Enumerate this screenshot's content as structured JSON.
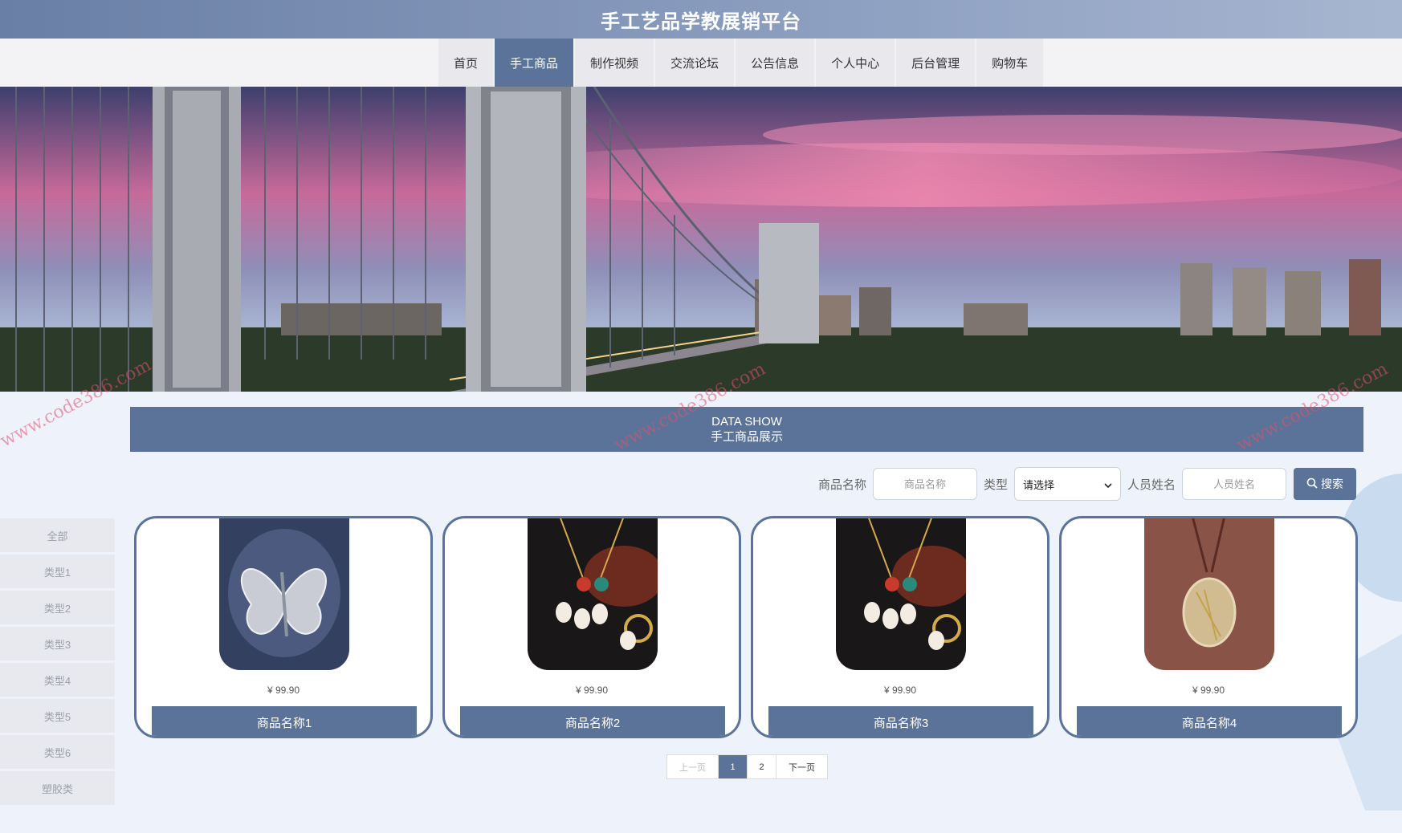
{
  "header": {
    "title": "手工艺品学教展销平台"
  },
  "nav": {
    "items": [
      {
        "label": "首页"
      },
      {
        "label": "手工商品"
      },
      {
        "label": "制作视频"
      },
      {
        "label": "交流论坛"
      },
      {
        "label": "公告信息"
      },
      {
        "label": "个人中心"
      },
      {
        "label": "后台管理"
      },
      {
        "label": "购物车"
      }
    ],
    "active_index": 1
  },
  "section": {
    "title_en": "DATA SHOW",
    "title_cn": "手工商品展示"
  },
  "search": {
    "name_label": "商品名称",
    "name_placeholder": "商品名称",
    "type_label": "类型",
    "type_selected": "请选择",
    "person_label": "人员姓名",
    "person_placeholder": "人员姓名",
    "button_label": "搜索"
  },
  "sidebar": {
    "items": [
      {
        "label": "全部"
      },
      {
        "label": "类型1"
      },
      {
        "label": "类型2"
      },
      {
        "label": "类型3"
      },
      {
        "label": "类型4"
      },
      {
        "label": "类型5"
      },
      {
        "label": "类型6"
      },
      {
        "label": "塑胶类"
      }
    ]
  },
  "products": [
    {
      "price": "¥ 99.90",
      "name": "商品名称1",
      "image": "butterfly-brooch"
    },
    {
      "price": "¥ 99.90",
      "name": "商品名称2",
      "image": "jade-jewelry-set"
    },
    {
      "price": "¥ 99.90",
      "name": "商品名称3",
      "image": "jade-jewelry-set"
    },
    {
      "price": "¥ 99.90",
      "name": "商品名称4",
      "image": "crystal-pendant"
    }
  ],
  "pagination": {
    "prev": "上一页",
    "pages": [
      "1",
      "2"
    ],
    "current": "1",
    "next": "下一页"
  },
  "watermark": "www.code386.com",
  "colors": {
    "primary": "#5b7398",
    "background": "#eef3fb"
  }
}
